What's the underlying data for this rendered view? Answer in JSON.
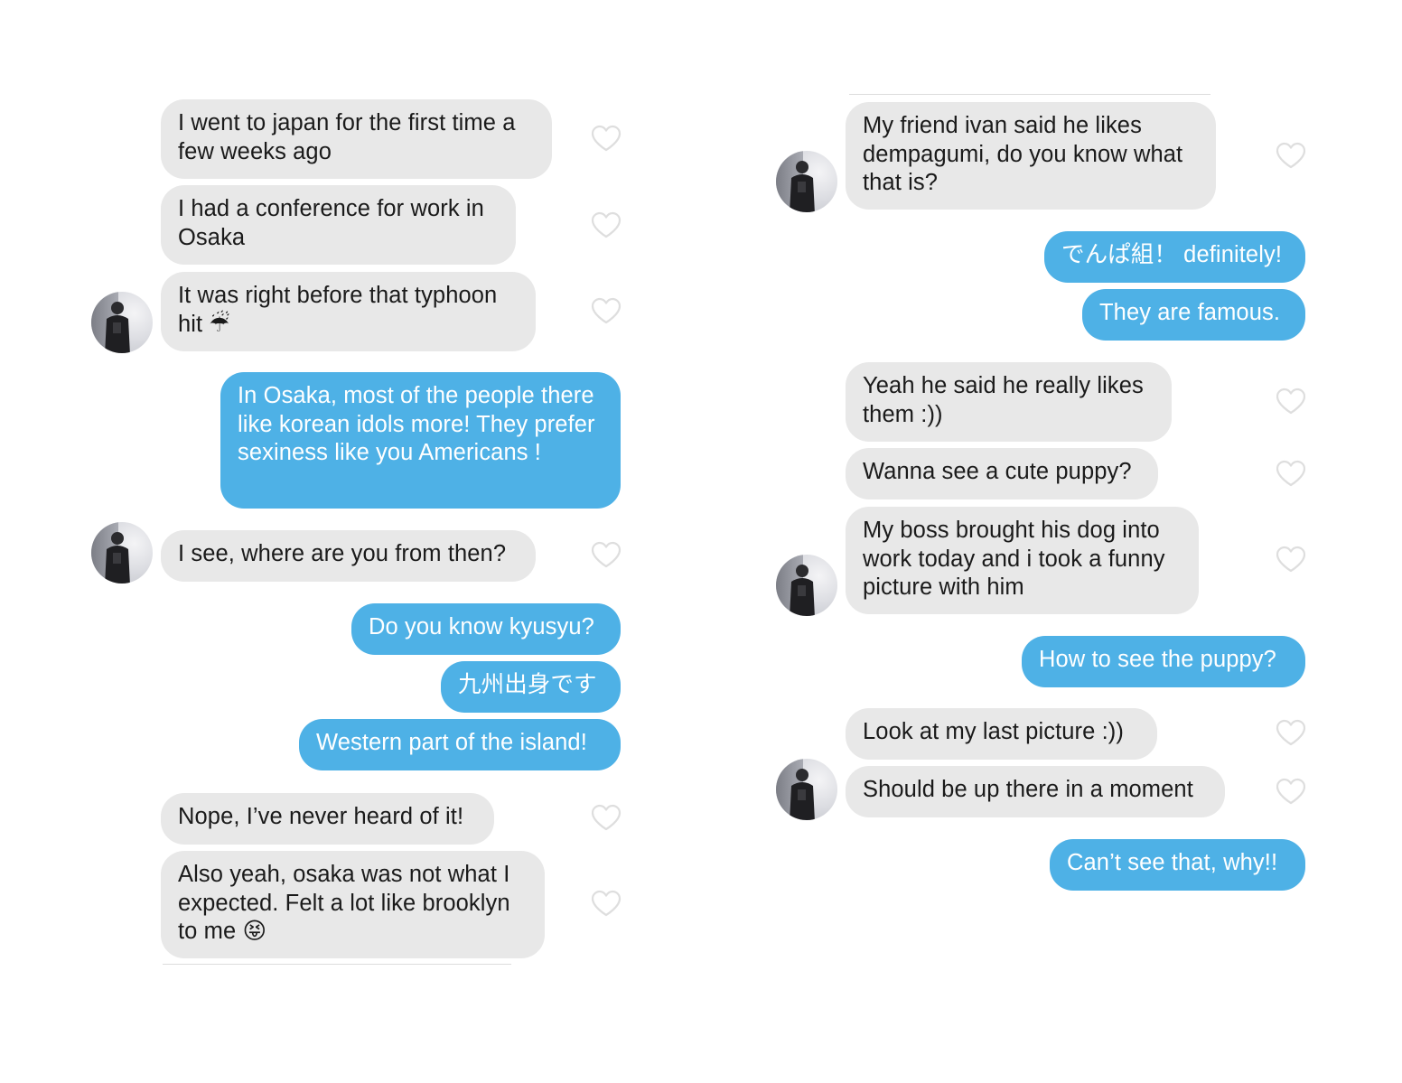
{
  "left_chat": {
    "messages": [
      {
        "type": "in",
        "text": "I went to japan for the first time a few weeks ago",
        "liked": false
      },
      {
        "type": "in",
        "text": "I had a conference for work in Osaka",
        "liked": false
      },
      {
        "type": "in",
        "text": "It was right before that typhoon hit ☔",
        "liked": false
      },
      {
        "type": "out",
        "text": "In Osaka, most of the people there like korean idols more! They prefer sexiness like you Americans !"
      },
      {
        "type": "in",
        "text": "I see, where are you from then?",
        "liked": false
      },
      {
        "type": "out",
        "text": "Do you know kyusyu?"
      },
      {
        "type": "out",
        "text": "九州出身です"
      },
      {
        "type": "out",
        "text": "Western part of the island!"
      },
      {
        "type": "in",
        "text": "Nope, I’ve never heard of it!",
        "liked": false
      },
      {
        "type": "in",
        "text": "Also yeah, osaka was not what I expected. Felt a lot like brooklyn to me 😝",
        "liked": false
      }
    ]
  },
  "right_chat": {
    "messages": [
      {
        "type": "in",
        "text": "My friend ivan said he likes dempagumi, do you know what that is?",
        "liked": false
      },
      {
        "type": "out",
        "text": "でんぱ組！ definitely!"
      },
      {
        "type": "out",
        "text": "They are famous."
      },
      {
        "type": "in",
        "text": "Yeah he said he really likes them :))",
        "liked": false
      },
      {
        "type": "in",
        "text": "Wanna see a cute puppy?",
        "liked": false
      },
      {
        "type": "in",
        "text": "My boss brought his dog into work today and i took a funny picture with him",
        "liked": false
      },
      {
        "type": "out",
        "text": "How to see the puppy?"
      },
      {
        "type": "in",
        "text": "Look at my last picture :))",
        "liked": false
      },
      {
        "type": "in",
        "text": "Should be up there in a moment",
        "liked": false
      },
      {
        "type": "out",
        "text": "Can’t see that, why!!"
      }
    ]
  },
  "icons": {
    "like": "heart-outline-icon",
    "avatar": "contact-avatar"
  },
  "colors": {
    "incoming_bubble": "#e8e8e8",
    "outgoing_bubble": "#4eb1e6",
    "heart_outline": "#dedede"
  }
}
